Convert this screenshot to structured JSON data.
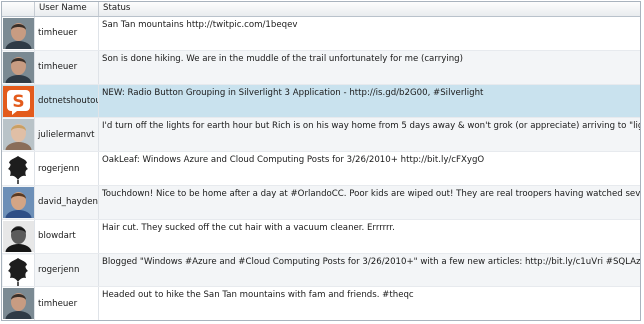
{
  "grid": {
    "columns": {
      "user_name": "User Name",
      "status": "Status"
    },
    "rows": [
      {
        "user": "timheuer",
        "status": "San Tan mountains  http://twitpic.com/1beqev",
        "avatar_icon": "person-photo-icon"
      },
      {
        "user": "timheuer",
        "status": "Son is done hiking. We are in the muddle of the trail unfortunately for me (carrying)",
        "avatar_icon": "person-photo-icon"
      },
      {
        "user": "dotnetshoutout",
        "status": "NEW: Radio Button Grouping in Silverlight 3 Application - http://is.gd/b2G00, #Silverlight",
        "avatar_icon": "shoutout-logo-icon"
      },
      {
        "user": "julielermanvt",
        "status": "I'd  turn off the lights for earth hour but Rich is on his way home from 5 days away & won't grok (or appreciate) arriving to \"lights out\"",
        "avatar_icon": "person-photo-icon"
      },
      {
        "user": "rogerjenn",
        "status": "OakLeaf: Windows Azure and Cloud Computing Posts for 3/26/2010+ http://bit.ly/cFXygO",
        "avatar_icon": "oak-leaf-icon"
      },
      {
        "user": "david_hayden",
        "status": "Touchdown! Nice to be home after a day at #OrlandoCC. Poor kids are wiped out! They are real troopers having watched several sessions :)",
        "avatar_icon": "person-photo-icon"
      },
      {
        "user": "blowdart",
        "status": "Hair cut. They sucked off the cut hair with a vacuum cleaner. Errrrrr.",
        "avatar_icon": "person-photo-icon"
      },
      {
        "user": "rogerjenn",
        "status": "Blogged \"Windows #Azure and #Cloud Computing Posts for 3/26/2010+\" with a few new articles: http://bit.ly/c1uVri #SQLAzure #OData #AtomPub",
        "avatar_icon": "oak-leaf-icon"
      },
      {
        "user": "timheuer",
        "status": "Headed out to hike the San Tan mountains with fam and friends. #theqc",
        "avatar_icon": "person-photo-icon"
      }
    ]
  }
}
